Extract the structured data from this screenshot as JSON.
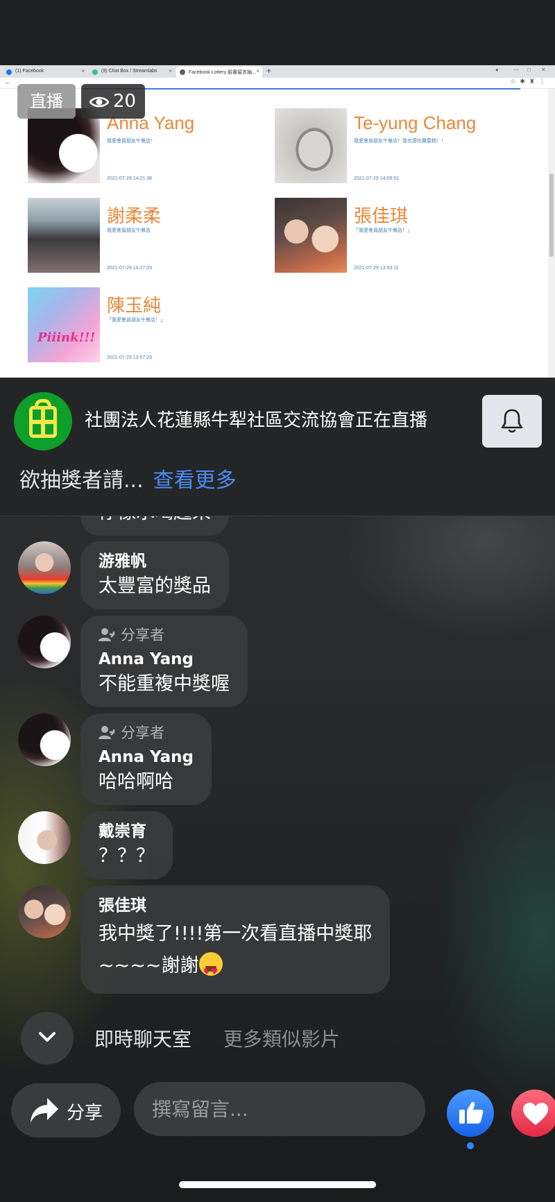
{
  "browser": {
    "tabs": [
      {
        "title": "(1) Facebook",
        "favicon_color": "#1877f2"
      },
      {
        "title": "(9) Chat Box / Streamlabs",
        "favicon_color": "#31c48d"
      },
      {
        "title": "Facebook Lottery 臉書留言抽...",
        "favicon_color": "#5f6368"
      }
    ],
    "new_tab": "+",
    "entries": [
      {
        "name": "Anna Yang",
        "message": "我愛會員朋友午餐店！",
        "time": "2021-07-29 14:21:38"
      },
      {
        "name": "Te-yung Chang",
        "message": "我愛會員朋友午餐店！我也愛吃蘿蔔糕！！",
        "time": "2021-07-29 14:09:52"
      },
      {
        "name": "謝柔柔",
        "message": "我愛會員朋友午餐店",
        "time": "2021-07-29 14:27:03"
      },
      {
        "name": "張佳琪",
        "message": "「我愛會員朋友午餐店！」",
        "time": "2021-07-29 13:53:11"
      },
      {
        "name": "陳玉純",
        "message": "「我愛會員朋友午餐店！」",
        "time": "2021-07-29 13:57:23"
      }
    ]
  },
  "live": {
    "badge": "直播",
    "viewer_count": "20"
  },
  "page": {
    "title": "社團法人花蓮縣牛犁社區交流協會正在直播",
    "description": "欲抽獎者請...",
    "see_more": "查看更多"
  },
  "comments": {
    "partial_text": "停像水喝起來",
    "items": [
      {
        "author": "游雅帆",
        "text": "太豐富的獎品",
        "tag": ""
      },
      {
        "author": "Anna Yang",
        "text": "不能重複中獎喔",
        "tag": "分享者"
      },
      {
        "author": "Anna Yang",
        "text": "哈哈啊哈",
        "tag": "分享者"
      },
      {
        "author": "戴崇育",
        "text": "？？？",
        "tag": ""
      },
      {
        "author": "張佳琪",
        "text_line1": "我中獎了!!!!第一次看直播中獎耶",
        "text_line2": "~~~~謝謝",
        "emoji": "smiling-face-with-heart-eyes"
      }
    ]
  },
  "tabs": {
    "chat": "即時聊天室",
    "similar": "更多類似影片"
  },
  "composer": {
    "share_label": "分享",
    "placeholder": "撰寫留言..."
  },
  "colors": {
    "accent": "#4b8bf5",
    "name_orange": "#e8883a",
    "like_blue": "#1763e6",
    "love_red": "#e22a45",
    "page_green": "#0d9f2a"
  }
}
